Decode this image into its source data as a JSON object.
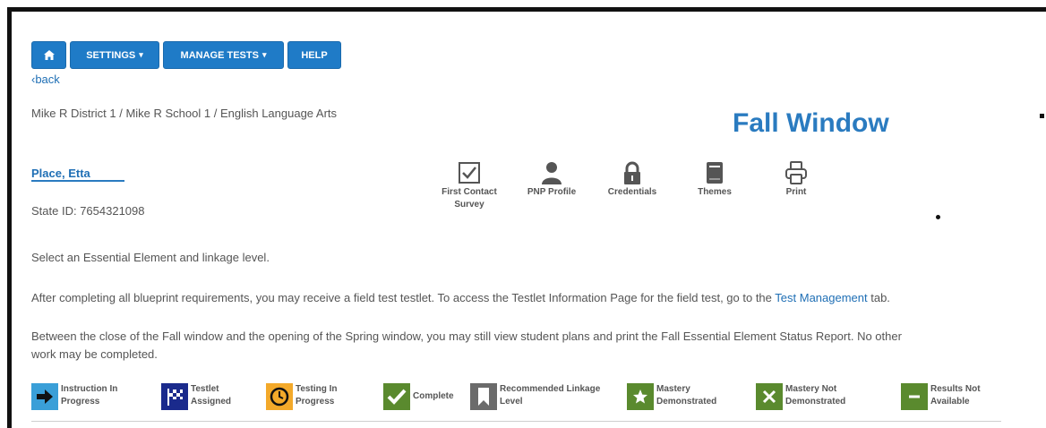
{
  "nav": {
    "home_icon": "home-icon",
    "settings": "SETTINGS",
    "manage_tests": "MANAGE TESTS",
    "help": "HELP",
    "accent": "#1f7bc7"
  },
  "back": "‹back",
  "breadcrumb": "Mike R District 1 / Mike R School 1 / English Language Arts",
  "window_title": "Fall Window",
  "student": {
    "name": "Place, Etta",
    "state_id": "State ID: 7654321098"
  },
  "tools": {
    "first_contact": [
      "First Contact",
      "Survey"
    ],
    "pnp_profile": "PNP Profile",
    "credentials": "Credentials",
    "themes": "Themes",
    "print": "Print"
  },
  "instructions": {
    "line1": "Select an Essential Element and linkage level.",
    "line2_before": "After completing all blueprint requirements, you may receive a field test testlet. To access the Testlet Information Page for the field test, go to the ",
    "line2_link": "Test Management",
    "line2_after": " tab.",
    "line3a": "Between the close of the Fall window and the opening of the Spring window, you may still view student plans and print the Fall Essential Element Status Report. No other",
    "line3b": "work may be completed."
  },
  "legend": {
    "instruction": [
      "Instruction In",
      "Progress"
    ],
    "testlet": [
      "Testlet",
      "Assigned"
    ],
    "testing": [
      "Testing In",
      "Progress"
    ],
    "complete": "Complete",
    "recommended": [
      "Recommended Linkage",
      "Level"
    ],
    "mastery": [
      "Mastery",
      "Demonstrated"
    ],
    "mastery_not": [
      "Mastery Not",
      "Demonstrated"
    ],
    "results_not": [
      "Results Not",
      "Available"
    ],
    "colors": {
      "blue": "#3a9fd8",
      "navy": "#1a2a8c",
      "orange": "#f3a92a",
      "green": "#5a8a2e",
      "gray": "#6b6b6b"
    }
  }
}
